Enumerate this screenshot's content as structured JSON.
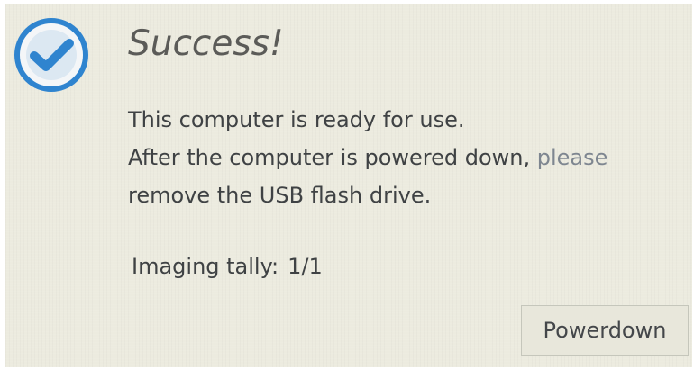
{
  "dialog": {
    "title": "Success!",
    "status_icon": "checkmark-circle-icon",
    "message_line_1": "This computer is ready for use.",
    "message_line_2_start": "After the computer is powered down,",
    "message_line_2_end": "please",
    "message_line_3": "remove the USB flash drive.",
    "tally_label": "Imaging tally:",
    "tally_value": "1/1",
    "powerdown_label": "Powerdown"
  },
  "colors": {
    "background": "#ecebdf",
    "icon_blue": "#2f84cf",
    "text": "#3f4244",
    "title_text": "#5b5b58"
  }
}
